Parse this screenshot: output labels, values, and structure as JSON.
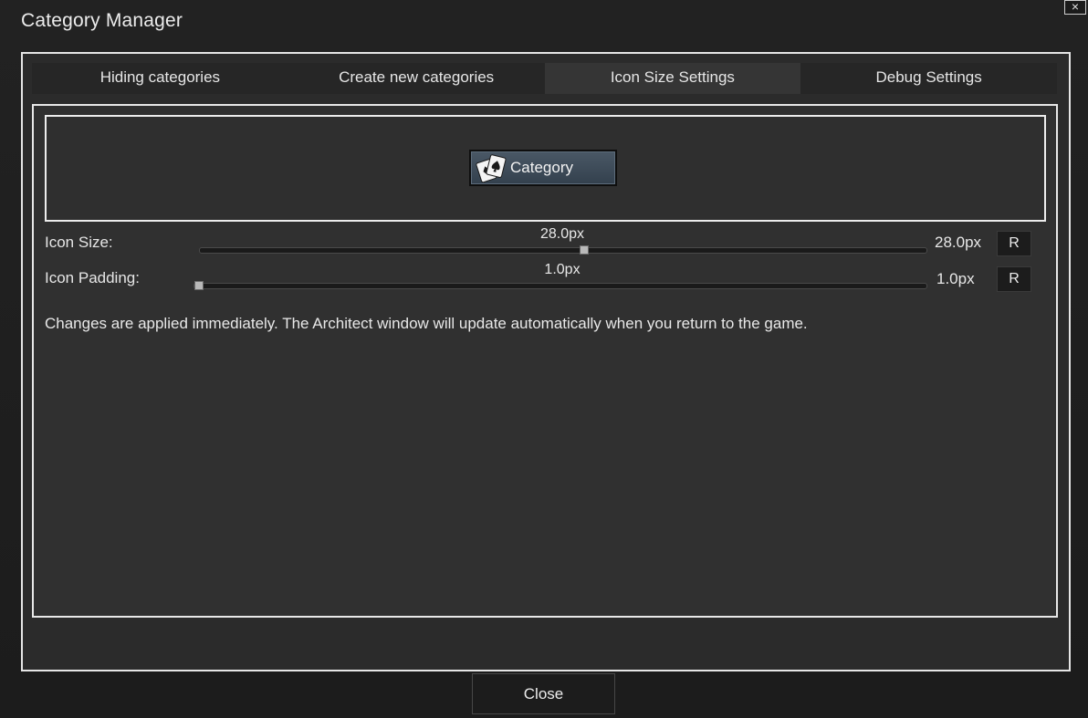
{
  "window": {
    "title": "Category Manager",
    "close_glyph": "×"
  },
  "tabs": [
    {
      "label": "Hiding categories",
      "active": false
    },
    {
      "label": "Create new categories",
      "active": false
    },
    {
      "label": "Icon Size Settings",
      "active": true
    },
    {
      "label": "Debug Settings",
      "active": false
    }
  ],
  "preview": {
    "button_label": "Category",
    "button_icon": "playing-cards-icon"
  },
  "icon_size": {
    "label": "Icon Size:",
    "value_text": "28.0px",
    "right_value_text": "28.0px",
    "slider_fraction": 0.53,
    "reset_label": "R"
  },
  "icon_padding": {
    "label": "Icon Padding:",
    "value_text": "1.0px",
    "right_value_text": "1.0px",
    "slider_fraction": 0.0,
    "reset_label": "R"
  },
  "info_text": "Changes are applied immediately. The Architect window will update automatically when you return to the game.",
  "footer": {
    "close_label": "Close"
  },
  "colors": {
    "background": "#1f1f1f",
    "panel": "#303030",
    "border": "#e8e8e8",
    "category_button": "#3f4c59"
  }
}
